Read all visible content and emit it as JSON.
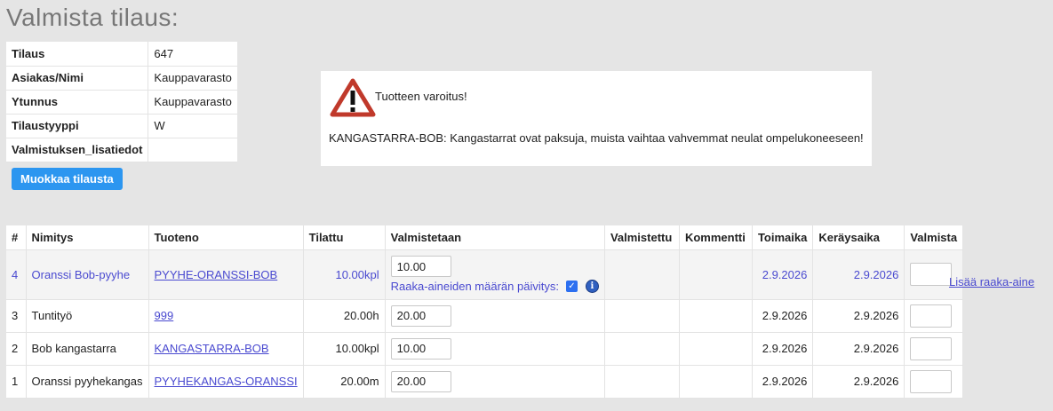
{
  "page": {
    "title": "Valmista tilaus:"
  },
  "order_info": [
    {
      "label": "Tilaus",
      "value": "647"
    },
    {
      "label": "Asiakas/Nimi",
      "value": "Kauppavarasto"
    },
    {
      "label": "Ytunnus",
      "value": "Kauppavarasto"
    },
    {
      "label": "Tilaustyyppi",
      "value": "W"
    },
    {
      "label": "Valmistuksen_lisatiedot",
      "value": ""
    }
  ],
  "edit_button": {
    "label": "Muokkaa tilausta"
  },
  "warning": {
    "icon": "warning-triangle-icon",
    "title": "Tuotteen varoitus!",
    "text": "KANGASTARRA-BOB: Kangastarrat ovat paksuja, muista vaihtaa vahvemmat neulat ompelukoneeseen!"
  },
  "table": {
    "headers": [
      "#",
      "Nimitys",
      "Tuoteno",
      "Tilattu",
      "Valmistetaan",
      "Valmistettu",
      "Kommentti",
      "Toimaika",
      "Keräysaika",
      "Valmista"
    ],
    "rows": [
      {
        "idx": "4",
        "name": "Oranssi Bob-pyyhe",
        "product": "PYYHE-ORANSSI-BOB",
        "ordered": "10.00kpl",
        "qty": "10.00",
        "made": "",
        "comment": "",
        "delivery": "2.9.2026",
        "picking": "2.9.2026"
      },
      {
        "idx": "3",
        "name": "Tuntityö",
        "product": "999",
        "ordered": "20.00h",
        "qty": "20.00",
        "made": "",
        "comment": "",
        "delivery": "2.9.2026",
        "picking": "2.9.2026"
      },
      {
        "idx": "2",
        "name": "Bob kangastarra",
        "product": "KANGASTARRA-BOB",
        "ordered": "10.00kpl",
        "qty": "10.00",
        "made": "",
        "comment": "",
        "delivery": "2.9.2026",
        "picking": "2.9.2026"
      },
      {
        "idx": "1",
        "name": "Oranssi pyyhekangas",
        "product": "PYYHEKANGAS-ORANSSI",
        "ordered": "20.00m",
        "qty": "20.00",
        "made": "",
        "comment": "",
        "delivery": "2.9.2026",
        "picking": "2.9.2026"
      }
    ],
    "raw_material_update_label": "Raaka-aineiden määrän päivitys:",
    "raw_material_update_checked": true,
    "add_raw_material_link": "Lisää raaka-aine"
  },
  "colors": {
    "link": "#4a4ad0",
    "button": "#2c96f0",
    "warning": "#c0392b"
  }
}
